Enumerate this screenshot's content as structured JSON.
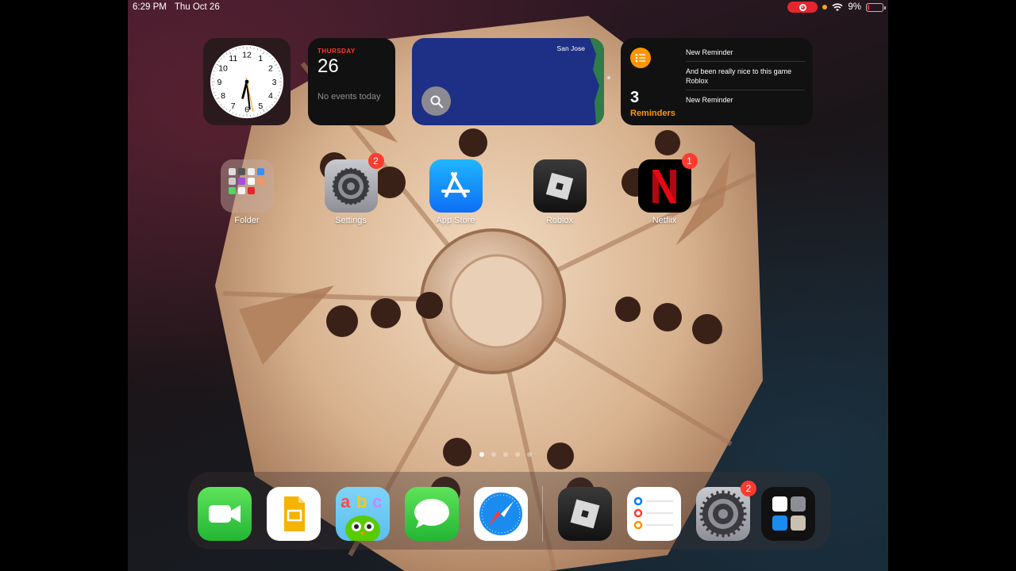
{
  "status_bar": {
    "time": "6:29 PM",
    "date": "Thu Oct 26",
    "battery_percent": "9%",
    "battery_level": 0.09,
    "recording_active": true
  },
  "widgets": {
    "clock": {
      "numbers": [
        "12",
        "1",
        "2",
        "3",
        "4",
        "5",
        "6",
        "7",
        "8",
        "9",
        "10",
        "11"
      ],
      "time_shown": "6:29"
    },
    "calendar": {
      "weekday": "THURSDAY",
      "day": "26",
      "events_text": "No events today"
    },
    "map": {
      "city": "San Jose"
    },
    "reminders": {
      "count": "3",
      "label": "Reminders",
      "items": [
        "New Reminder",
        "And been really nice to this game Roblox",
        "New Reminder"
      ]
    }
  },
  "apps": [
    {
      "label": "Folder",
      "icon": "folder-icon"
    },
    {
      "label": "Settings",
      "icon": "settings-gear-icon",
      "badge": "2"
    },
    {
      "label": "App Store",
      "icon": "app-store-icon"
    },
    {
      "label": "Roblox",
      "icon": "roblox-icon"
    },
    {
      "label": "Netflix",
      "icon": "netflix-icon",
      "badge": "1"
    }
  ],
  "page_dots": {
    "count": 5,
    "active": 0
  },
  "dock": {
    "apps": [
      "facetime-icon",
      "google-slides-icon",
      "abc-duolingo-icon",
      "messages-icon",
      "safari-icon"
    ],
    "recent": [
      "roblox-icon",
      "reminders-icon",
      "settings-gear-icon",
      "app-library-icon"
    ],
    "settings_badge": "2"
  },
  "colors": {
    "accent_orange": "#ff9500",
    "badge_red": "#ff3b30",
    "map_blue": "#1e2f86"
  }
}
